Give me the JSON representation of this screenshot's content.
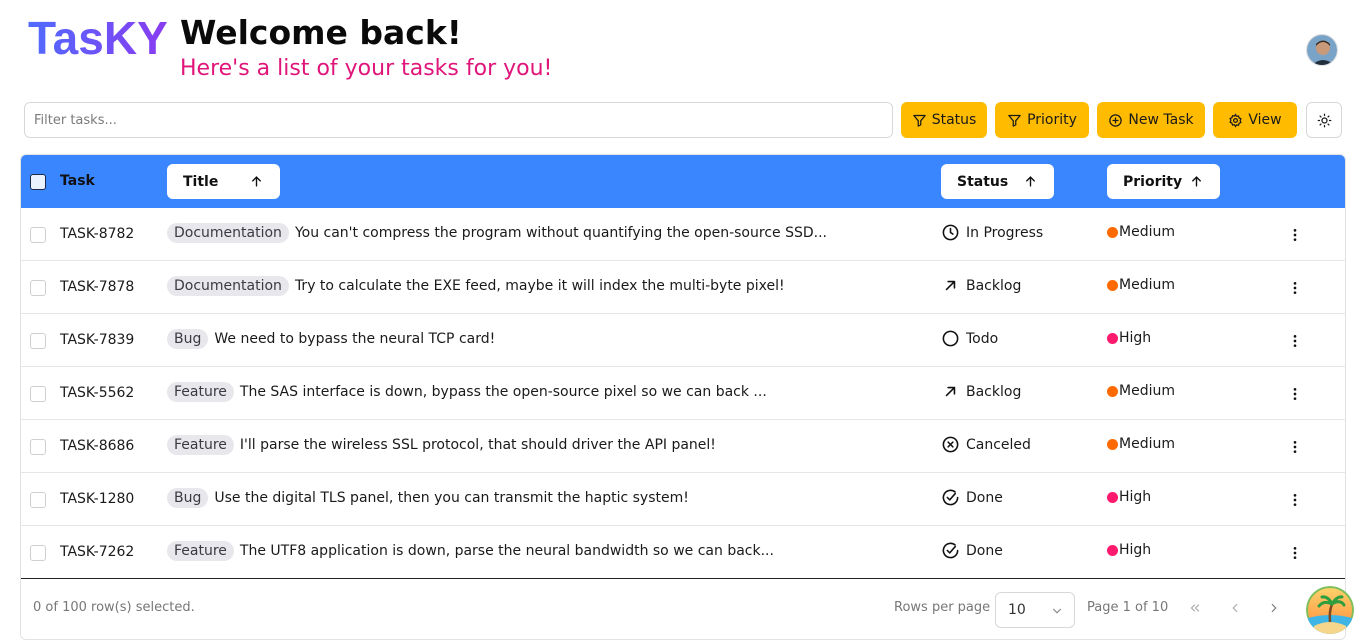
{
  "app": {
    "logo": "TasKY"
  },
  "header": {
    "title": "Welcome back!",
    "subtitle": "Here's a list of your tasks for you!"
  },
  "toolbar": {
    "filter_placeholder": "Filter tasks...",
    "status_label": "Status",
    "priority_label": "Priority",
    "new_task_label": "New Task",
    "view_label": "View"
  },
  "table": {
    "columns": {
      "task": "Task",
      "title": "Title",
      "status": "Status",
      "priority": "Priority"
    },
    "rows": [
      {
        "id": "TASK-8782",
        "label": "Documentation",
        "title": "You can't compress the program without quantifying the open-source SSD...",
        "status": "In Progress",
        "status_icon": "clock-icon",
        "priority": "Medium"
      },
      {
        "id": "TASK-7878",
        "label": "Documentation",
        "title": "Try to calculate the EXE feed, maybe it will index the multi-byte pixel!",
        "status": "Backlog",
        "status_icon": "arrow-up-right-icon",
        "priority": "Medium"
      },
      {
        "id": "TASK-7839",
        "label": "Bug",
        "title": "We need to bypass the neural TCP card!",
        "status": "Todo",
        "status_icon": "circle-icon",
        "priority": "High"
      },
      {
        "id": "TASK-5562",
        "label": "Feature",
        "title": "The SAS interface is down, bypass the open-source pixel so we can back ...",
        "status": "Backlog",
        "status_icon": "arrow-up-right-icon",
        "priority": "Medium"
      },
      {
        "id": "TASK-8686",
        "label": "Feature",
        "title": "I'll parse the wireless SSL protocol, that should driver the API panel!",
        "status": "Canceled",
        "status_icon": "x-circle-icon",
        "priority": "Medium"
      },
      {
        "id": "TASK-1280",
        "label": "Bug",
        "title": "Use the digital TLS panel, then you can transmit the haptic system!",
        "status": "Done",
        "status_icon": "check-circle-icon",
        "priority": "High"
      },
      {
        "id": "TASK-7262",
        "label": "Feature",
        "title": "The UTF8 application is down, parse the neural bandwidth so we can back...",
        "status": "Done",
        "status_icon": "check-circle-icon",
        "priority": "High"
      }
    ]
  },
  "priority_colors": {
    "Medium": "#ff6a00",
    "High": "#ff1a6e"
  },
  "colors": {
    "accent": "#ffbb00",
    "header_bg": "#3a86ff",
    "subtitle": "#e0157a"
  },
  "footer": {
    "selection": "0 of 100 row(s) selected.",
    "rows_per_page_label": "Rows per page",
    "rows_per_page_value": "10",
    "page_info": "Page 1 of 10"
  }
}
